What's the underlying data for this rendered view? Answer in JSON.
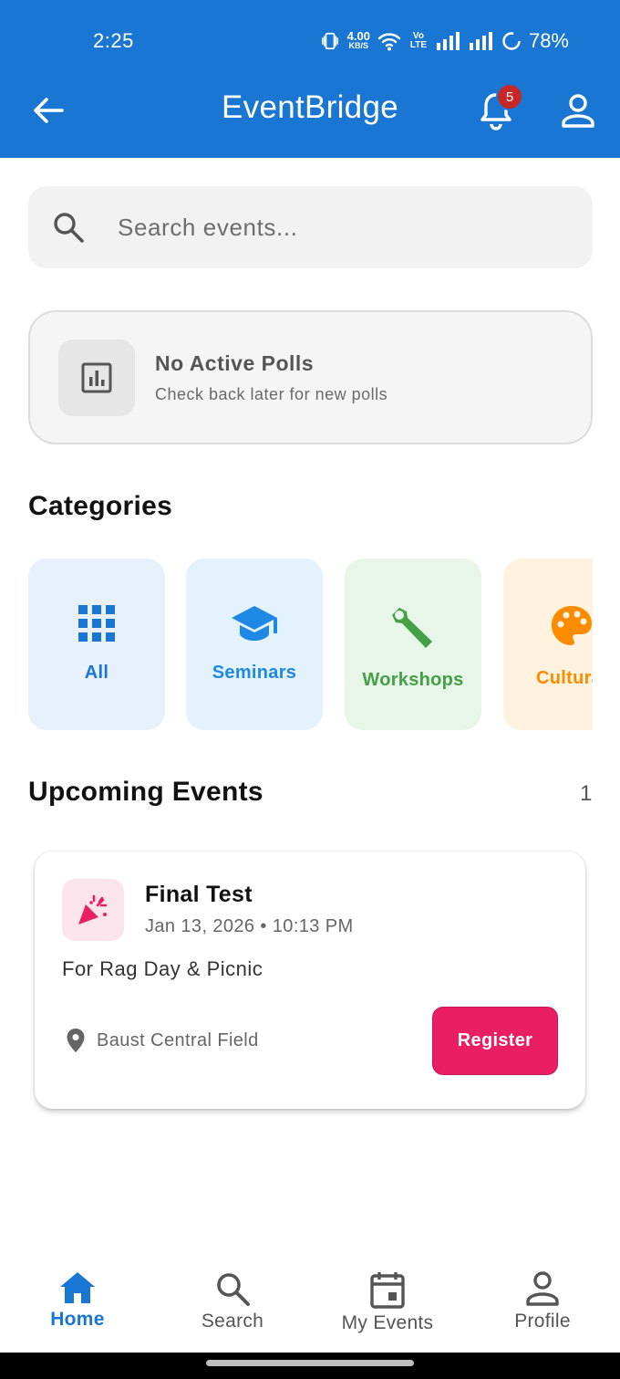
{
  "status_bar": {
    "time": "2:25",
    "net_speed_value": "4.00",
    "net_speed_unit": "KB/S",
    "volte": "Vo LTE",
    "battery_pct": "78%"
  },
  "app_bar": {
    "title": "EventBridge",
    "notification_count": "5",
    "back_icon": "arrow-left-icon",
    "bell_icon": "bell-icon",
    "profile_icon": "person-icon"
  },
  "search": {
    "placeholder": "Search events...",
    "value": ""
  },
  "polls": {
    "title": "No Active Polls",
    "subtitle": "Check back later for new polls"
  },
  "categories": {
    "title": "Categories",
    "items": [
      {
        "label": "All",
        "icon": "grid-icon",
        "color": "#1976d2",
        "bg": "#e8f0fb"
      },
      {
        "label": "Seminars",
        "icon": "school-icon",
        "color": "#1e88e5",
        "bg": "#e3f2fd"
      },
      {
        "label": "Workshops",
        "icon": "wrench-icon",
        "color": "#43a047",
        "bg": "#e8f5e9"
      },
      {
        "label": "Cultural",
        "icon": "palette-icon",
        "color": "#fb8c00",
        "bg": "#fff3e0"
      }
    ]
  },
  "upcoming": {
    "title": "Upcoming Events",
    "count": "1",
    "events": [
      {
        "title": "Final Test",
        "datetime": "Jan 13, 2026 • 10:13 PM",
        "description": "For Rag Day & Picnic",
        "location": "Baust Central Field",
        "register_label": "Register",
        "icon": "party-popper-icon"
      }
    ]
  },
  "bottom_nav": {
    "active": "Home",
    "items": [
      {
        "label": "Home",
        "icon": "home-icon"
      },
      {
        "label": "Search",
        "icon": "search-icon"
      },
      {
        "label": "My Events",
        "icon": "calendar-icon"
      },
      {
        "label": "Profile",
        "icon": "person-icon"
      }
    ]
  },
  "colors": {
    "primary": "#1976d2",
    "accent": "#e91e63",
    "badge": "#c62828"
  }
}
